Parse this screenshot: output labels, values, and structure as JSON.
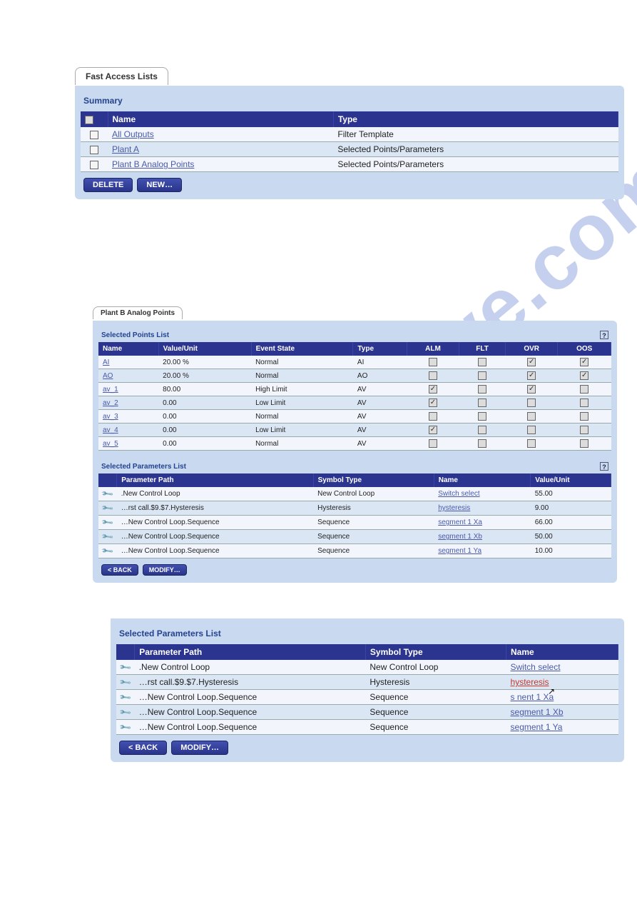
{
  "panel1": {
    "tab": "Fast Access Lists",
    "section": "Summary",
    "cols": {
      "name": "Name",
      "type": "Type"
    },
    "rows": [
      {
        "name": "All Outputs",
        "type": "Filter Template"
      },
      {
        "name": "Plant A",
        "type": "Selected Points/Parameters"
      },
      {
        "name": "Plant B Analog Points",
        "type": "Selected Points/Parameters"
      }
    ],
    "buttons": {
      "delete": "DELETE",
      "new": "NEW…"
    }
  },
  "panel2": {
    "tab": "Plant B Analog Points",
    "pointsTitle": "Selected Points List",
    "pointsCols": {
      "name": "Name",
      "value": "Value/Unit",
      "state": "Event State",
      "type": "Type",
      "alm": "ALM",
      "flt": "FLT",
      "ovr": "OVR",
      "oos": "OOS"
    },
    "pointsRows": [
      {
        "name": "AI",
        "value": "20.00 %",
        "state": "Normal",
        "type": "AI",
        "alm": false,
        "flt": false,
        "ovr": true,
        "oos": true
      },
      {
        "name": "AO",
        "value": "20.00 %",
        "state": "Normal",
        "type": "AO",
        "alm": false,
        "flt": false,
        "ovr": true,
        "oos": true
      },
      {
        "name": "av_1",
        "value": "80.00",
        "state": "High Limit",
        "type": "AV",
        "alm": true,
        "flt": false,
        "ovr": true,
        "oos": false
      },
      {
        "name": "av_2",
        "value": "0.00",
        "state": "Low Limit",
        "type": "AV",
        "alm": true,
        "flt": false,
        "ovr": false,
        "oos": false
      },
      {
        "name": "av_3",
        "value": "0.00",
        "state": "Normal",
        "type": "AV",
        "alm": false,
        "flt": false,
        "ovr": false,
        "oos": false
      },
      {
        "name": "av_4",
        "value": "0.00",
        "state": "Low Limit",
        "type": "AV",
        "alm": true,
        "flt": false,
        "ovr": false,
        "oos": false
      },
      {
        "name": "av_5",
        "value": "0.00",
        "state": "Normal",
        "type": "AV",
        "alm": false,
        "flt": false,
        "ovr": false,
        "oos": false
      }
    ],
    "paramsTitle": "Selected Parameters List",
    "paramsCols": {
      "path": "Parameter Path",
      "symbol": "Symbol Type",
      "name": "Name",
      "value": "Value/Unit"
    },
    "paramsRows": [
      {
        "path": ".New Control Loop",
        "symbol": "New Control Loop",
        "name": "Switch select",
        "value": "55.00"
      },
      {
        "path": "…rst call.$9.$7.Hysteresis",
        "symbol": "Hysteresis",
        "name": "hysteresis",
        "value": "9.00"
      },
      {
        "path": "…New Control Loop.Sequence",
        "symbol": "Sequence",
        "name": "segment 1 Xa",
        "value": "66.00"
      },
      {
        "path": "…New Control Loop.Sequence",
        "symbol": "Sequence",
        "name": "segment 1 Xb",
        "value": "50.00"
      },
      {
        "path": "…New Control Loop.Sequence",
        "symbol": "Sequence",
        "name": "segment 1 Ya",
        "value": "10.00"
      }
    ],
    "buttons": {
      "back": "< BACK",
      "modify": "MODIFY…"
    }
  },
  "panel3": {
    "title": "Selected Parameters List",
    "cols": {
      "path": "Parameter Path",
      "symbol": "Symbol Type",
      "name": "Name"
    },
    "rows": [
      {
        "path": ".New Control Loop",
        "symbol": "New Control Loop",
        "name": "Switch select",
        "red": false,
        "cursor": false
      },
      {
        "path": "…rst call.$9.$7.Hysteresis",
        "symbol": "Hysteresis",
        "name": "hysteresis",
        "red": true,
        "cursor": true
      },
      {
        "path": "…New Control Loop.Sequence",
        "symbol": "Sequence",
        "name": "s      nent 1 Xa",
        "red": false,
        "cursor": false
      },
      {
        "path": "…New Control Loop.Sequence",
        "symbol": "Sequence",
        "name": "segment 1 Xb",
        "red": false,
        "cursor": false
      },
      {
        "path": "…New Control Loop.Sequence",
        "symbol": "Sequence",
        "name": "segment 1 Ya",
        "red": false,
        "cursor": false
      }
    ],
    "buttons": {
      "back": "< BACK",
      "modify": "MODIFY…"
    }
  },
  "icons": {
    "wrench": "wrench-icon",
    "help": "help-icon",
    "checkbox": "checkbox",
    "cursor": "cursor-icon"
  }
}
